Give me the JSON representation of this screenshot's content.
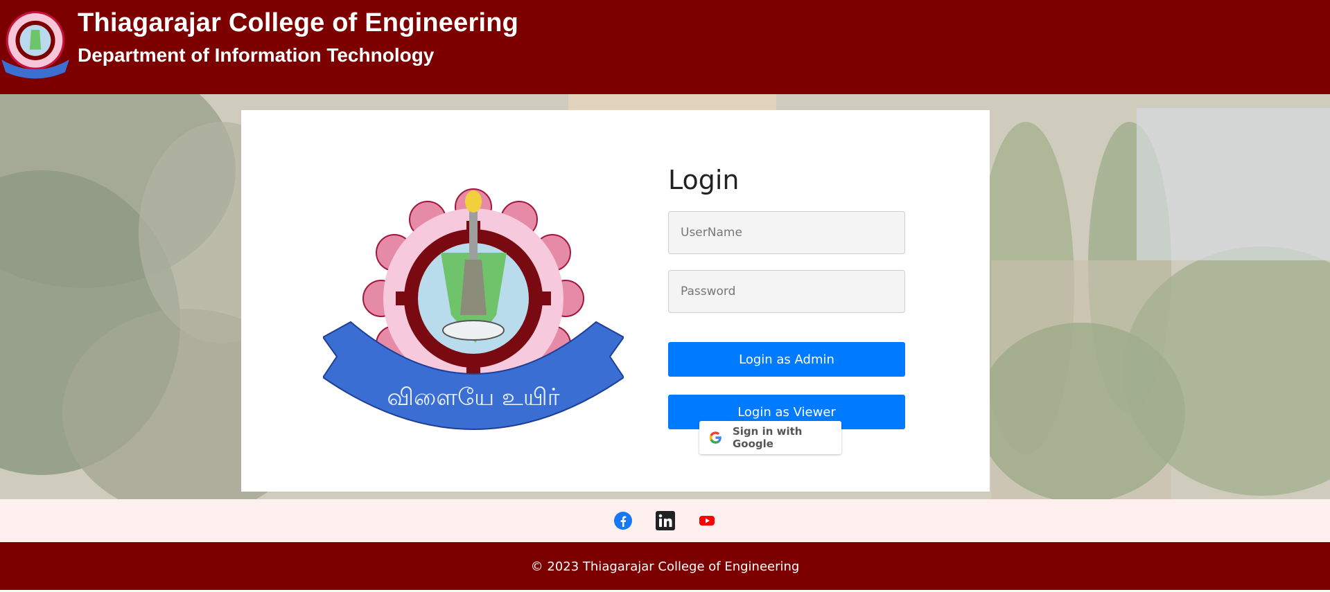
{
  "header": {
    "title": "Thiagarajar College of Engineering",
    "subtitle": "Department of Information Technology",
    "logo_icon": "college-emblem-icon"
  },
  "login": {
    "title": "Login",
    "username_placeholder": "UserName",
    "password_placeholder": "Password",
    "admin_button": "Login as Admin",
    "viewer_button": "Login as Viewer",
    "google_button": "Sign in with Google",
    "emblem_motto": "விளையே உயிர்"
  },
  "social": [
    {
      "name": "facebook",
      "icon": "facebook-icon"
    },
    {
      "name": "linkedin",
      "icon": "linkedin-icon"
    },
    {
      "name": "youtube",
      "icon": "youtube-icon"
    }
  ],
  "footer": {
    "copyright": "© 2023 Thiagarajar College of Engineering"
  },
  "colors": {
    "brand": "#7d0000",
    "primary_button": "#007bff",
    "social_strip": "#fff0f0"
  }
}
